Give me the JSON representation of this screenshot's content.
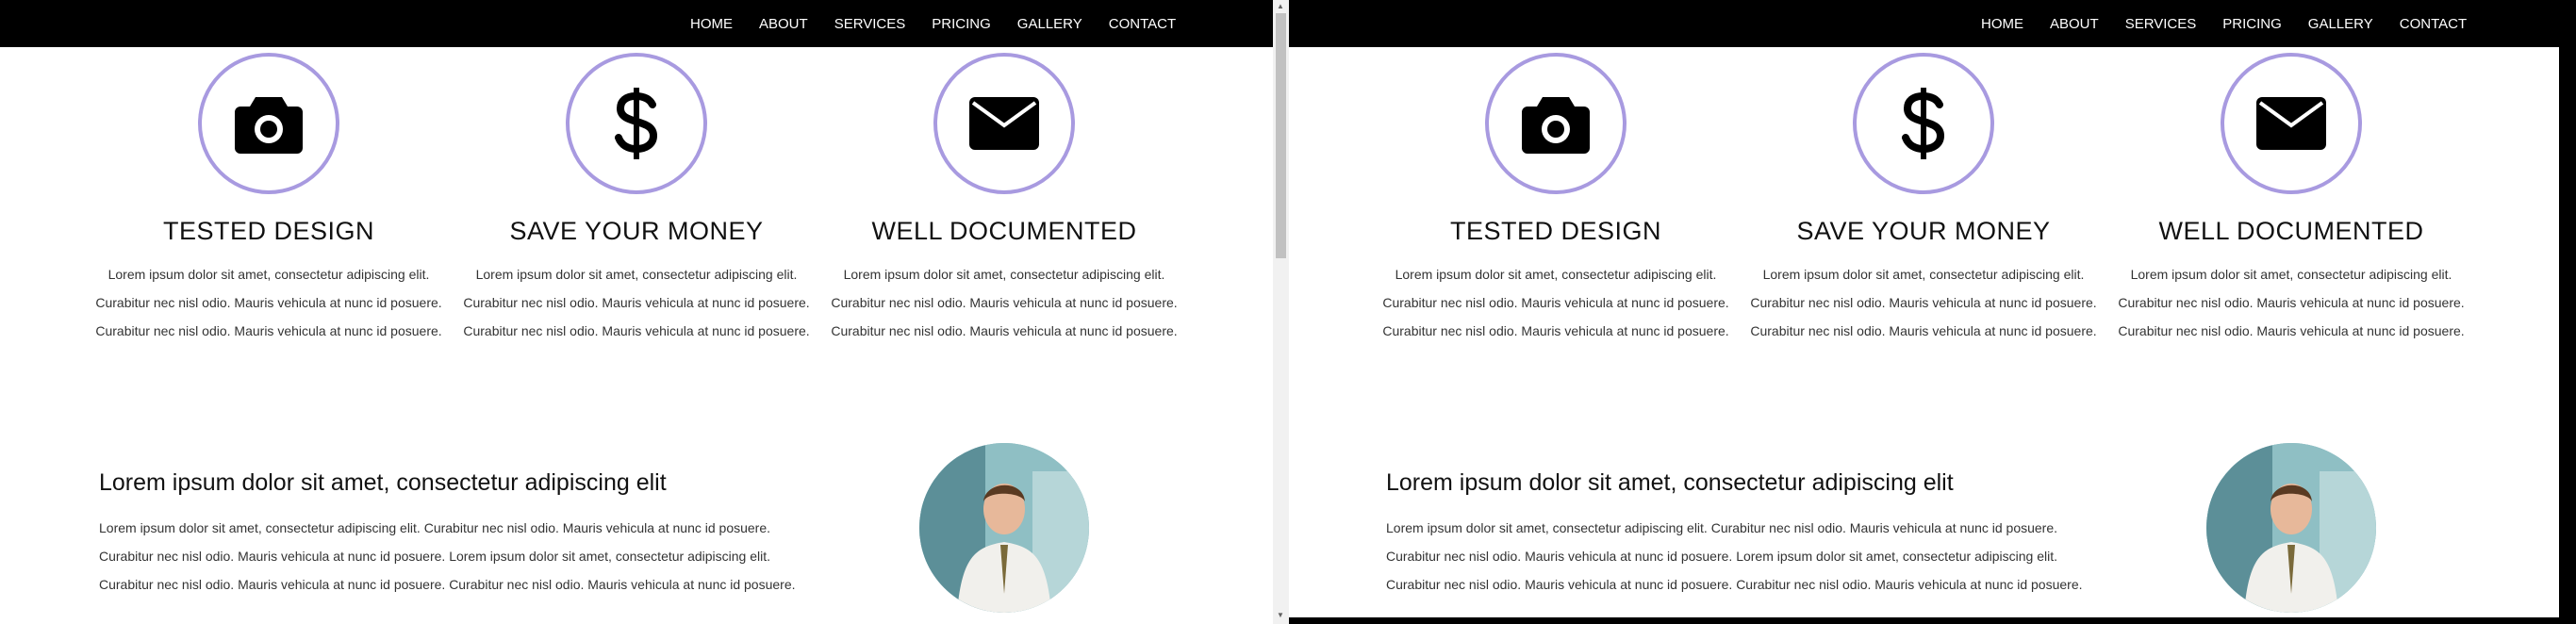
{
  "nav": {
    "items": [
      {
        "label": "HOME"
      },
      {
        "label": "ABOUT"
      },
      {
        "label": "SERVICES"
      },
      {
        "label": "PRICING"
      },
      {
        "label": "GALLERY"
      },
      {
        "label": "CONTACT"
      }
    ]
  },
  "features": [
    {
      "icon": "camera-icon",
      "title": "TESTED DESIGN",
      "text": "Lorem ipsum dolor sit amet, consectetur adipiscing elit. Curabitur nec nisl odio. Mauris vehicula at nunc id posuere. Curabitur nec nisl odio. Mauris vehicula at nunc id posuere."
    },
    {
      "icon": "dollar-icon",
      "title": "SAVE YOUR MONEY",
      "text": "Lorem ipsum dolor sit amet, consectetur adipiscing elit. Curabitur nec nisl odio. Mauris vehicula at nunc id posuere. Curabitur nec nisl odio. Mauris vehicula at nunc id posuere."
    },
    {
      "icon": "envelope-icon",
      "title": "WELL DOCUMENTED",
      "text": "Lorem ipsum dolor sit amet, consectetur adipiscing elit. Curabitur nec nisl odio. Mauris vehicula at nunc id posuere. Curabitur nec nisl odio. Mauris vehicula at nunc id posuere."
    }
  ],
  "about": {
    "title": "Lorem ipsum dolor sit amet, consectetur adipiscing elit",
    "text": "Lorem ipsum dolor sit amet, consectetur adipiscing elit. Curabitur nec nisl odio. Mauris vehicula at nunc id posuere. Curabitur nec nisl odio. Mauris vehicula at nunc id posuere. Lorem ipsum dolor sit amet, consectetur adipiscing elit. Curabitur nec nisl odio. Mauris vehicula at nunc id posuere. Curabitur nec nisl odio. Mauris vehicula at nunc id posuere."
  },
  "colors": {
    "navbar": "#000000",
    "circle_border": "#a89ae0",
    "icon": "#000000"
  }
}
